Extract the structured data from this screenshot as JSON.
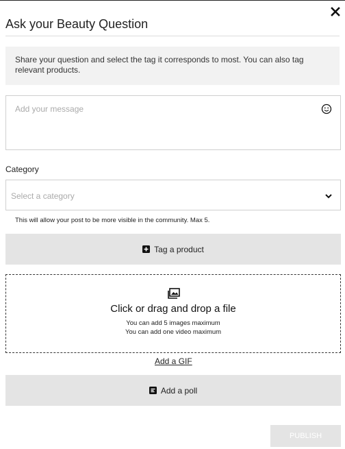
{
  "modal": {
    "title": "Ask your Beauty Question",
    "close_icon": "close-icon"
  },
  "info": {
    "text": "Share your question and select the tag it corresponds to most. You can also tag relevant products."
  },
  "message": {
    "placeholder": "Add your message",
    "emoji_icon": "smiley-icon"
  },
  "category": {
    "label": "Category",
    "placeholder": "Select a category",
    "hint": "This will allow your post to be more visible in the community. Max 5.",
    "chevron_icon": "chevron-down-icon"
  },
  "tag_product": {
    "label": "Tag a product",
    "icon": "plus-square-icon"
  },
  "dropzone": {
    "icon": "image-upload-icon",
    "title": "Click or drag and drop a file",
    "line1": "You can add 5 images maximum",
    "line2": "You can add one video maximum"
  },
  "gif": {
    "label": "Add a GIF"
  },
  "poll": {
    "label": "Add a poll",
    "icon": "poll-icon"
  },
  "publish": {
    "label": "PUBLISH"
  },
  "colors": {
    "button_gray": "#e4e4e4",
    "panel_gray": "#f2f2f2",
    "border": "#cfcfcf",
    "text": "#222222",
    "placeholder": "#aaaaaa"
  }
}
